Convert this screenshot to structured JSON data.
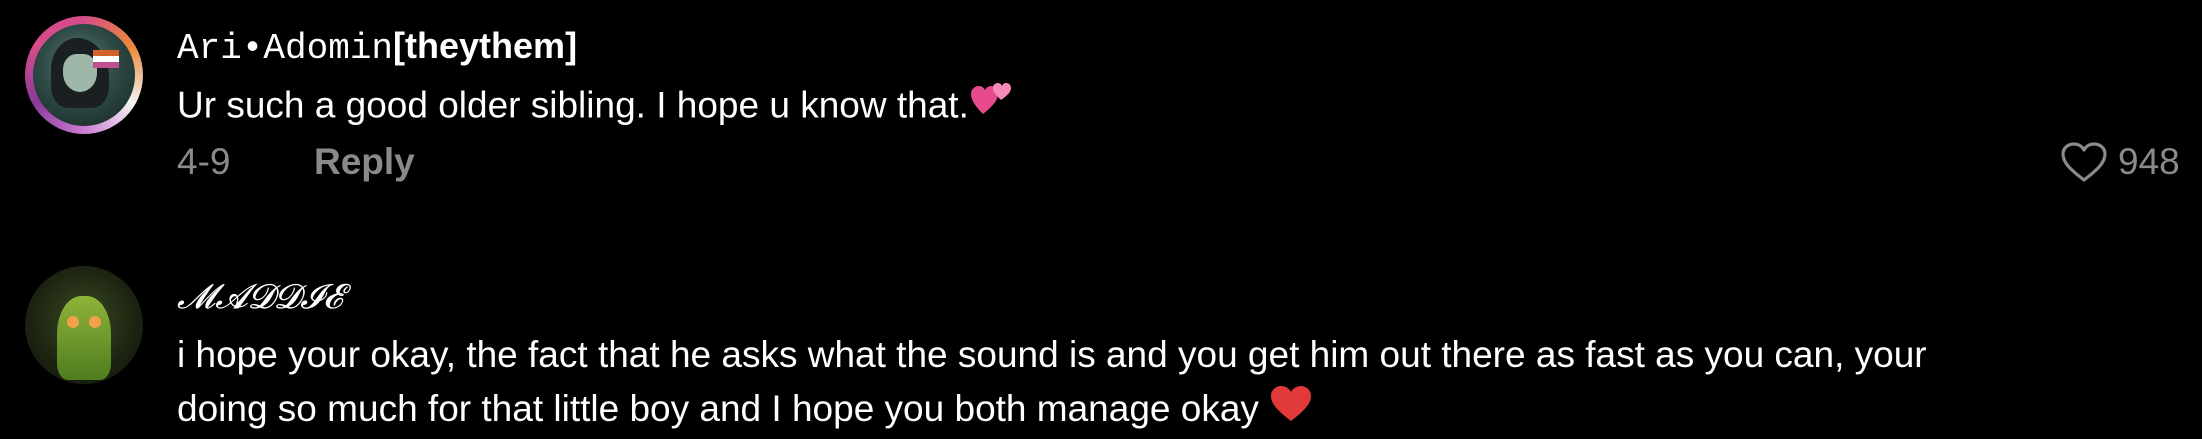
{
  "comments": [
    {
      "username_parts": [
        "Ari•Adomin",
        "[theythem]"
      ],
      "text": "Ur such a good older sibling. I hope u know that.",
      "emoji": "💕",
      "date": "4-9",
      "reply_label": "Reply",
      "likes": "948",
      "avatar_icon": "avatar-image"
    },
    {
      "username": "𝓜𝓐𝓓𝓓𝓘𝓔",
      "text_line1": "i hope your okay, the fact that he asks what the sound is and you get him out there as fast as you can, your",
      "text_line2": "doing so much for that little boy and I hope you both manage okay",
      "emoji": "❤️",
      "avatar_icon": "avatar-image"
    }
  ],
  "colors": {
    "background": "#000000",
    "text": "#ffffff",
    "muted": "#8a8a8a",
    "emoji_heart": "#e23a3a",
    "emoji_pink": "#f06aa8"
  },
  "icons": {
    "like": "heart-outline-icon"
  }
}
